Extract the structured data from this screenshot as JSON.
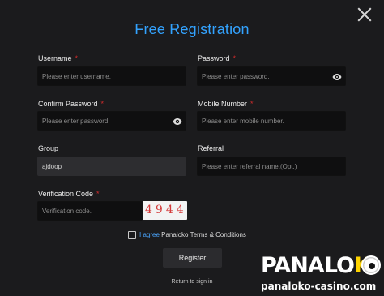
{
  "title": "Free Registration",
  "fields": {
    "username": {
      "label": "Username",
      "required_mark": "*",
      "placeholder": "Please enter username."
    },
    "password": {
      "label": "Password",
      "required_mark": "*",
      "placeholder": "Please enter password."
    },
    "confirm_password": {
      "label": "Confirm Password",
      "required_mark": "*",
      "placeholder": "Please enter password."
    },
    "mobile_number": {
      "label": "Mobile Number",
      "required_mark": "*",
      "placeholder": "Please enter mobile number."
    },
    "group": {
      "label": "Group",
      "value": "ajdoop"
    },
    "referral": {
      "label": "Referral",
      "placeholder": "Please enter referral name.(Opt.)"
    },
    "verification_code": {
      "label": "Verification Code",
      "required_mark": "*",
      "placeholder": "Verification code."
    }
  },
  "captcha": {
    "text": "4944"
  },
  "agree": {
    "prefix": "I agree",
    "text": " Panaloko Terms & Conditions"
  },
  "buttons": {
    "register": "Register",
    "return_to_sign_in": "Return to sign in"
  },
  "brand": {
    "logo_main": "PANALO",
    "logo_k": "K",
    "logo_domain": "panaloko-casino.com"
  },
  "colors": {
    "title": "#33a3ff",
    "required": "#d12b2b",
    "captcha": "#d43a3a",
    "logo_accent": "#ffd400"
  },
  "icons": {
    "close": "close-icon",
    "eye": "eye-icon"
  }
}
